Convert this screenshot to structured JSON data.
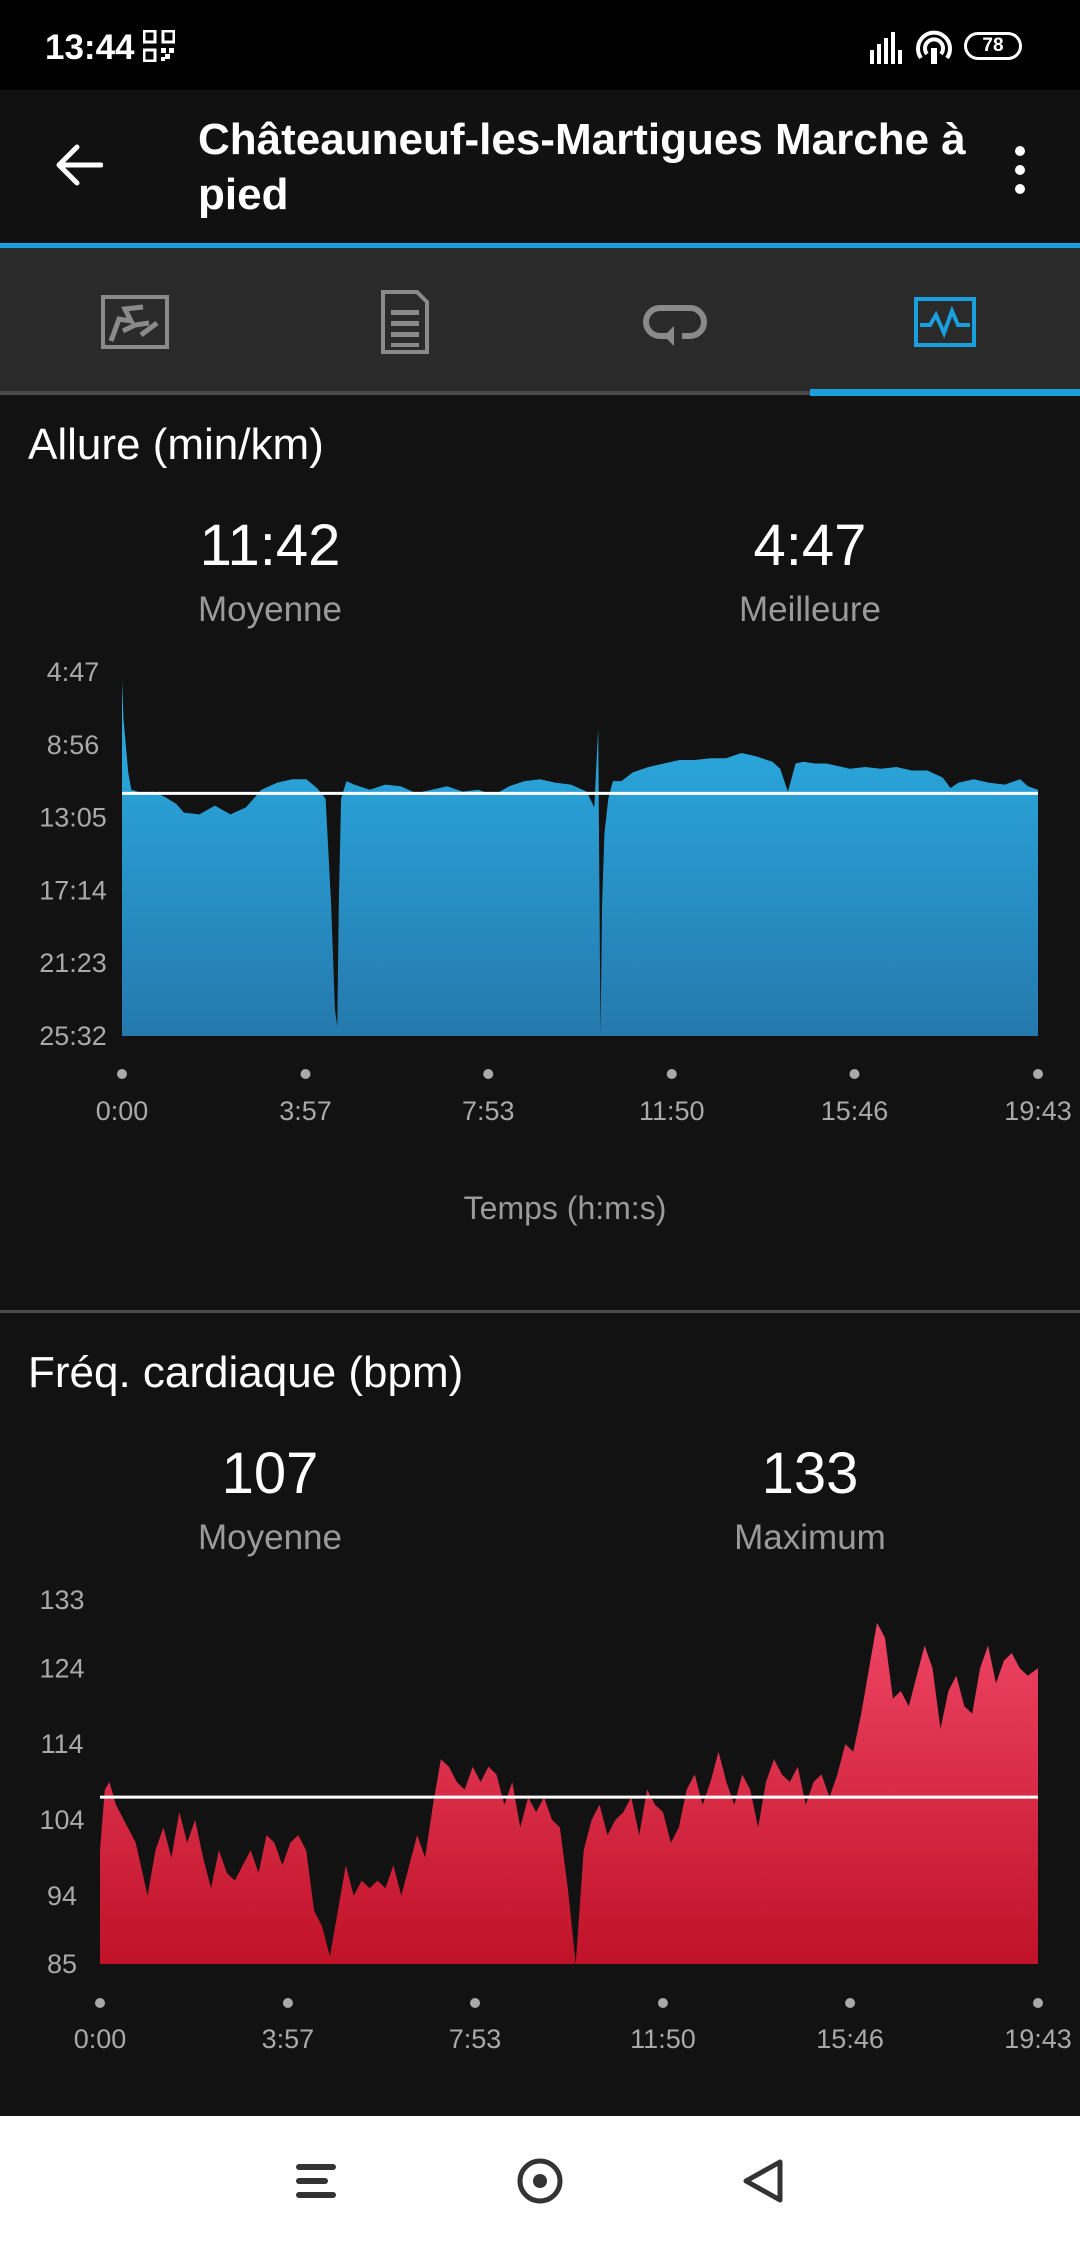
{
  "status": {
    "time": "13:44",
    "battery": "78"
  },
  "header": {
    "title": "Châteauneuf-les-Martigues Marche à pied"
  },
  "tabs": [
    {
      "icon": "map-icon"
    },
    {
      "icon": "details-icon"
    },
    {
      "icon": "laps-icon"
    },
    {
      "icon": "charts-icon",
      "active": true
    }
  ],
  "pace": {
    "title": "Allure (min/km)",
    "avg_value": "11:42",
    "avg_label": "Moyenne",
    "best_value": "4:47",
    "best_label": "Meilleure",
    "xlabel": "Temps (h:m:s)"
  },
  "heart": {
    "title": "Fréq. cardiaque (bpm)",
    "avg_value": "107",
    "avg_label": "Moyenne",
    "max_value": "133",
    "max_label": "Maximum"
  },
  "colors": {
    "accent": "#1a9fde",
    "pace_fill": "#2aa6dc",
    "hr_fill": "#e0304c",
    "avg_line": "#ffffff"
  },
  "chart_data": [
    {
      "type": "area",
      "title": "Allure (min/km)",
      "xlabel": "Temps (h:m:s)",
      "ylabel": "Allure (min/km)",
      "y_inverted": true,
      "y_unit": "minutes per km",
      "ylim": [
        4.783,
        25.533
      ],
      "yticks": [
        4.783,
        8.933,
        13.083,
        17.233,
        21.383,
        25.533
      ],
      "ytick_labels": [
        "4:47",
        "8:56",
        "13:05",
        "17:14",
        "21:23",
        "25:32"
      ],
      "x_unit": "minutes",
      "xlim": [
        0,
        1183
      ],
      "xticks": [
        0,
        237,
        473,
        710,
        946,
        1183
      ],
      "xtick_labels": [
        "0:00",
        "3:57",
        "7:53",
        "11:50",
        "15:46",
        "19:43"
      ],
      "average": 11.7,
      "average_label": "11:42",
      "x": [
        0,
        2,
        5,
        8,
        12,
        20,
        30,
        40,
        55,
        70,
        80,
        100,
        120,
        140,
        160,
        180,
        200,
        220,
        238,
        252,
        263,
        270,
        275,
        278,
        280,
        283,
        290,
        300,
        320,
        340,
        360,
        380,
        400,
        420,
        440,
        460,
        480,
        500,
        520,
        540,
        560,
        580,
        600,
        610,
        615,
        618,
        620,
        623,
        628,
        634,
        645,
        660,
        680,
        700,
        720,
        740,
        760,
        780,
        800,
        820,
        840,
        850,
        860,
        870,
        880,
        895,
        910,
        920,
        940,
        960,
        980,
        1000,
        1020,
        1040,
        1060,
        1070,
        1080,
        1100,
        1120,
        1140,
        1160,
        1170,
        1183
      ],
      "y": [
        5.2,
        7.5,
        9.0,
        10.5,
        11.5,
        11.6,
        11.8,
        11.6,
        11.9,
        12.3,
        12.8,
        12.9,
        12.4,
        12.9,
        12.5,
        11.5,
        11.1,
        10.9,
        10.9,
        11.4,
        12.0,
        18.0,
        24.0,
        25.0,
        18.0,
        12.0,
        11.0,
        11.2,
        11.5,
        11.2,
        11.3,
        11.7,
        11.5,
        11.3,
        11.6,
        11.5,
        11.8,
        11.3,
        11.0,
        10.9,
        11.1,
        11.2,
        11.6,
        12.5,
        8.0,
        25.5,
        18.0,
        14.0,
        12.0,
        11.0,
        11.0,
        10.5,
        10.2,
        10.0,
        9.8,
        9.8,
        9.7,
        9.7,
        9.4,
        9.6,
        9.9,
        10.3,
        11.6,
        10.0,
        9.9,
        10.0,
        10.0,
        10.1,
        10.3,
        10.2,
        10.3,
        10.2,
        10.4,
        10.4,
        10.8,
        11.4,
        11.1,
        10.9,
        11.1,
        11.2,
        10.9,
        11.3,
        11.5
      ]
    },
    {
      "type": "area",
      "title": "Fréq. cardiaque (bpm)",
      "ylabel": "Fréq. cardiaque (bpm)",
      "ylim": [
        85,
        133
      ],
      "yticks": [
        85,
        94,
        104,
        114,
        124,
        133
      ],
      "x_unit": "minutes",
      "xlim": [
        0,
        1183
      ],
      "xticks": [
        0,
        237,
        473,
        710,
        946,
        1183
      ],
      "xtick_labels": [
        "0:00",
        "3:57",
        "7:53",
        "11:50",
        "15:46",
        "19:43"
      ],
      "average": 107,
      "x": [
        0,
        6,
        12,
        20,
        30,
        45,
        60,
        65,
        70,
        80,
        90,
        100,
        110,
        120,
        130,
        140,
        150,
        160,
        170,
        180,
        190,
        200,
        210,
        220,
        230,
        240,
        250,
        260,
        270,
        280,
        290,
        300,
        310,
        320,
        330,
        340,
        350,
        360,
        370,
        380,
        390,
        400,
        410,
        420,
        430,
        440,
        450,
        460,
        470,
        480,
        490,
        500,
        510,
        520,
        530,
        540,
        550,
        560,
        570,
        580,
        590,
        600,
        610,
        620,
        630,
        640,
        650,
        660,
        670,
        680,
        690,
        700,
        710,
        720,
        730,
        740,
        750,
        760,
        770,
        780,
        790,
        800,
        810,
        820,
        830,
        840,
        850,
        860,
        870,
        880,
        890,
        900,
        910,
        920,
        930,
        940,
        950,
        960,
        970,
        980,
        990,
        1000,
        1010,
        1020,
        1030,
        1040,
        1050,
        1060,
        1070,
        1080,
        1090,
        1100,
        1110,
        1120,
        1130,
        1140,
        1150,
        1160,
        1170,
        1183
      ],
      "y": [
        100,
        108,
        109,
        106,
        104,
        101,
        94,
        97,
        100,
        103,
        99,
        105,
        101,
        104,
        99,
        95,
        100,
        97,
        96,
        98,
        100,
        97,
        102,
        101,
        98,
        101,
        102,
        100,
        92,
        90,
        86,
        92,
        98,
        94,
        96,
        95,
        96,
        95,
        98,
        94,
        98,
        102,
        99,
        106,
        112,
        111,
        109,
        108,
        111,
        109,
        111,
        110,
        106,
        109,
        103,
        107,
        105,
        107,
        104,
        103,
        95,
        85,
        100,
        104,
        106,
        102,
        104,
        105,
        107,
        102,
        108,
        106,
        105,
        101,
        103,
        108,
        110,
        106,
        109,
        113,
        109,
        106,
        110,
        108,
        103,
        109,
        112,
        110,
        109,
        111,
        106,
        109,
        110,
        107,
        110,
        114,
        113,
        118,
        124,
        130,
        128,
        120,
        121,
        119,
        123,
        127,
        124,
        116,
        121,
        123,
        119,
        118,
        124,
        127,
        122,
        125,
        126,
        124,
        123,
        124
      ]
    }
  ]
}
